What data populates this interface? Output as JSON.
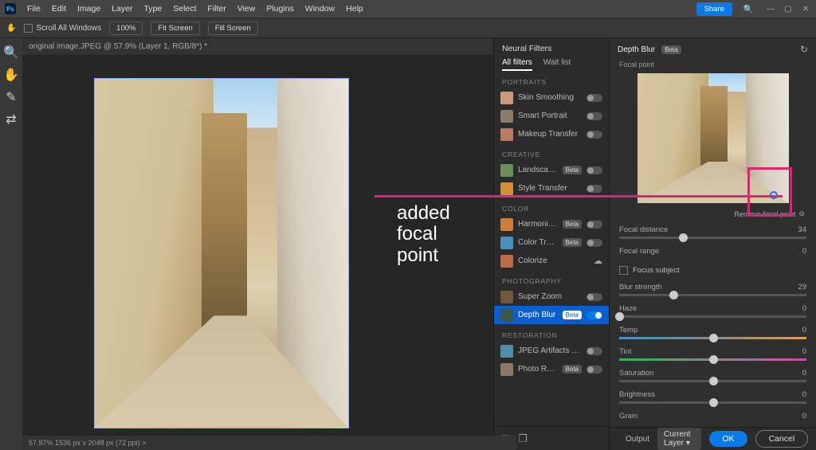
{
  "menu": [
    "File",
    "Edit",
    "Image",
    "Layer",
    "Type",
    "Select",
    "Filter",
    "View",
    "Plugins",
    "Window",
    "Help"
  ],
  "app_logo": "Ps",
  "share": "Share",
  "optbar": {
    "hand": "✋",
    "scroll": "Scroll All Windows",
    "zoom": "100%",
    "fit": "Fit Screen",
    "fill": "Fill Screen"
  },
  "doctab": "original image.JPEG @ 57.9% (Layer 1, RGB/8*) *",
  "statusbar": "57.87%   1536 px x 2048 px (72 ppi)  >",
  "annotation": {
    "l1": "added",
    "l2": "focal",
    "l3": "point"
  },
  "nf": {
    "title": "Neural Filters",
    "tabs": [
      "All filters",
      "Wait list"
    ],
    "cats": {
      "0": "PORTRAITS",
      "1": "CREATIVE",
      "2": "COLOR",
      "3": "PHOTOGRAPHY",
      "4": "RESTORATION"
    },
    "items": {
      "ss": "Skin Smoothing",
      "sp": "Smart Portrait",
      "mt": "Makeup Transfer",
      "lm": "Landscape Mixer",
      "st": "Style Transfer",
      "hm": "Harmonization",
      "ct": "Color Transfer",
      "cz": "Colorize",
      "sz": "Super Zoom",
      "db": "Depth Blur",
      "jar": "JPEG Artifacts Removal",
      "pr": "Photo Restoration"
    },
    "beta": "Beta"
  },
  "db": {
    "title": "Depth Blur",
    "focal_point": "Focal point",
    "remove": "Remove focal point",
    "focal_distance": {
      "label": "Focal distance",
      "val": "34"
    },
    "focal_range": {
      "label": "Focal range",
      "val": "0"
    },
    "focus_subject": "Focus subject",
    "blur": {
      "label": "Blur strength",
      "val": "29"
    },
    "haze": {
      "label": "Haze",
      "val": "0"
    },
    "temp": {
      "label": "Temp",
      "val": "0"
    },
    "tint": {
      "label": "Tint",
      "val": "0"
    },
    "sat": {
      "label": "Saturation",
      "val": "0"
    },
    "bri": {
      "label": "Brightness",
      "val": "0"
    },
    "grain": {
      "label": "Grain",
      "val": "0"
    }
  },
  "footer": {
    "output": "Output",
    "layer": "Current Layer",
    "ok": "OK",
    "cancel": "Cancel"
  }
}
